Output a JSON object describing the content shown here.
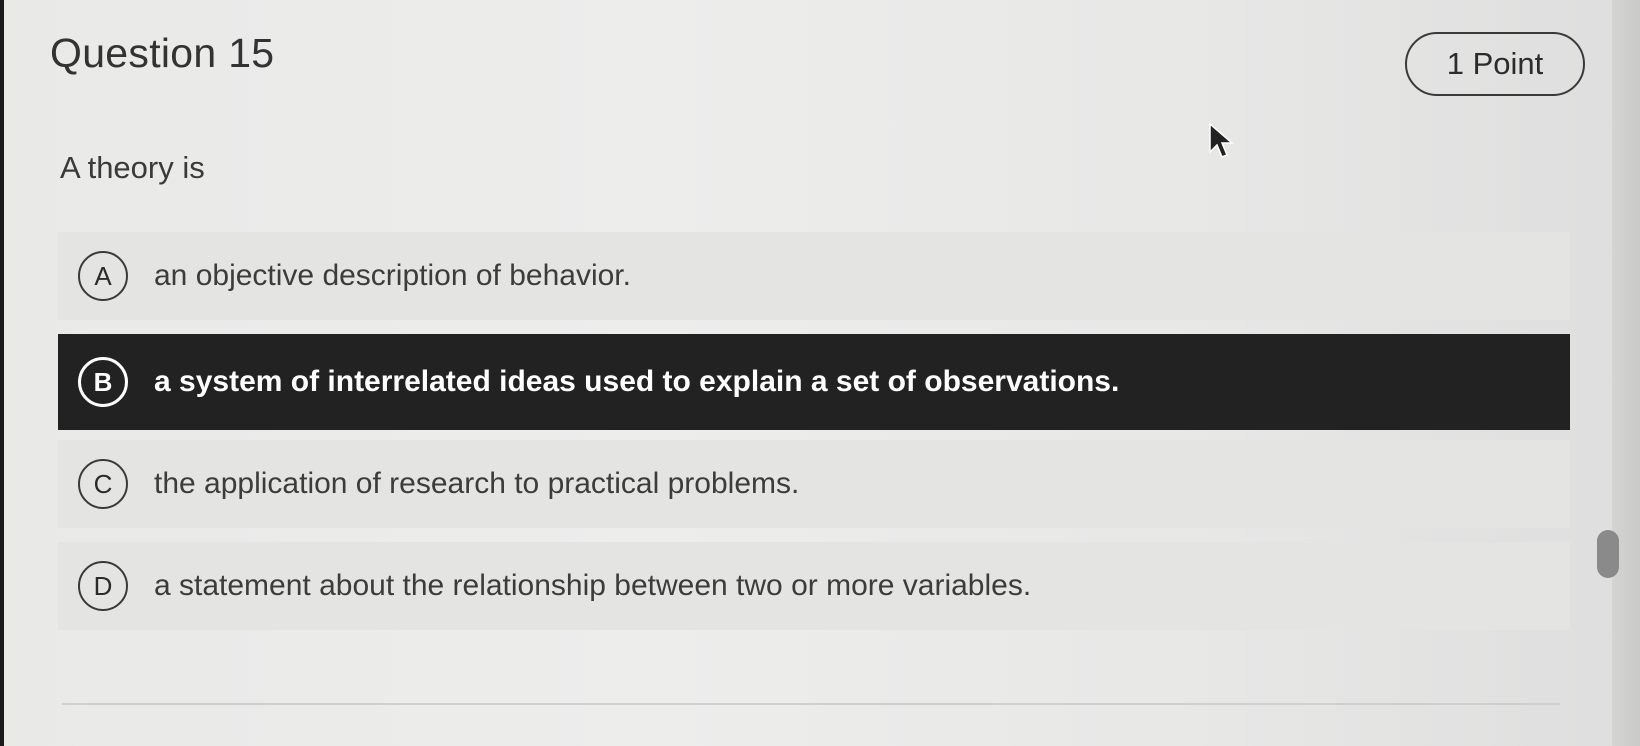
{
  "question": {
    "title": "Question 15",
    "points": "1 Point",
    "prompt": "A theory is"
  },
  "options": [
    {
      "letter": "A",
      "text": "an objective description of behavior."
    },
    {
      "letter": "B",
      "text": "a system of interrelated ideas used to explain a set of observations."
    },
    {
      "letter": "C",
      "text": "the application of research to practical problems."
    },
    {
      "letter": "D",
      "text": "a statement about the relationship between two or more variables."
    }
  ],
  "selected_option": "B",
  "colors": {
    "selected_bg": "#222222",
    "selected_text": "#ffffff",
    "option_bg": "#e4e4e3",
    "page_bg": "#ececeb"
  },
  "icons": {
    "cursor": "mouse-pointer-icon"
  }
}
